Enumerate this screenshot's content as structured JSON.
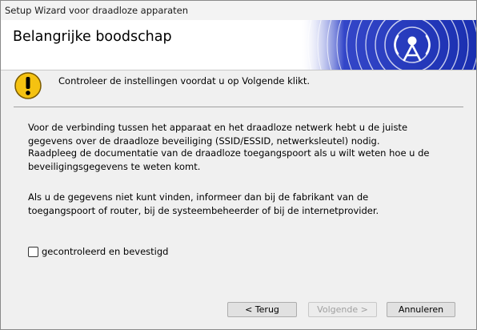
{
  "window": {
    "title": "Setup Wizard voor draadloze apparaten"
  },
  "header": {
    "title": "Belangrijke boodschap"
  },
  "warning": {
    "text": "Controleer de instellingen voordat u op Volgende klikt."
  },
  "body": {
    "paragraph1": "Voor de verbinding tussen het apparaat en het draadloze netwerk hebt u de juiste gegevens over de draadloze beveiliging (SSID/ESSID, netwerksleutel) nodig.",
    "paragraph2": "Raadpleeg de documentatie van de draadloze toegangspoort als u wilt weten hoe u de beveiligingsgegevens te weten komt.",
    "paragraph3": "Als u de gegevens niet kunt vinden, informeer dan bij de fabrikant van de toegangspoort of router, bij de systeembeheerder of bij de internetprovider."
  },
  "checkbox": {
    "label": "gecontroleerd en bevestigd",
    "checked": false
  },
  "buttons": {
    "back": "< Terug",
    "next": "Volgende >",
    "cancel": "Annuleren"
  },
  "icons": {
    "warning": "warning-exclamation-icon",
    "wireless": "wireless-antenna-icon"
  },
  "colors": {
    "banner_blue": "#1a2fb0",
    "warning_yellow": "#f5c211"
  }
}
